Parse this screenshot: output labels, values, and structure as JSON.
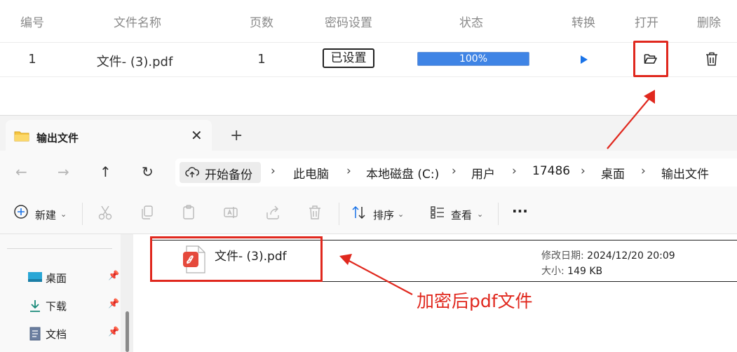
{
  "table": {
    "headers": [
      "编号",
      "文件名称",
      "页数",
      "密码设置",
      "状态",
      "转换",
      "打开",
      "删除"
    ],
    "row": {
      "index": "1",
      "file_name": "文件- (3).pdf",
      "pages": "1",
      "password_status": "已设置",
      "progress_text": "100%",
      "progress": 1.0
    }
  },
  "explorer": {
    "tab_title": "输出文件",
    "tab_close": "✕",
    "new_tab": "+",
    "breadcrumb": {
      "backup": "开始备份",
      "items": [
        "此电脑",
        "本地磁盘 (C:)",
        "用户",
        "17486",
        "桌面",
        "输出文件"
      ]
    },
    "toolbar": {
      "new_label": "新建",
      "sort_label": "排序",
      "view_label": "查看",
      "more": "···"
    },
    "sidebar": [
      {
        "label": "桌面",
        "icon": "desktop-icon"
      },
      {
        "label": "下载",
        "icon": "download-icon"
      },
      {
        "label": "文档",
        "icon": "document-icon"
      }
    ],
    "file": {
      "name": "文件- (3).pdf",
      "modified_label": "修改日期:",
      "modified": "2024/12/20 20:09",
      "size_label": "大小:",
      "size": "149 KB"
    }
  },
  "annotation": {
    "text": "加密后pdf文件",
    "color": "#e0281e"
  },
  "colors": {
    "accent": "#1a73e8",
    "progress": "#3f84e5",
    "highlight": "#e0281e"
  }
}
